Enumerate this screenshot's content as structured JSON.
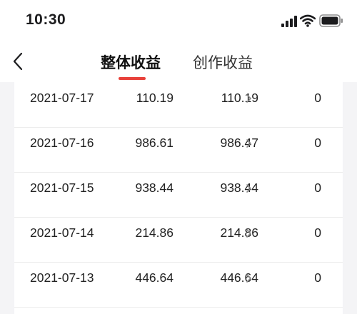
{
  "status_bar": {
    "time": "10:30"
  },
  "nav": {
    "tabs": [
      {
        "label": "整体收益",
        "active": true
      },
      {
        "label": "创作收益",
        "active": false
      }
    ],
    "accent_color": "#e8413a"
  },
  "rows": [
    {
      "date": "2021-07-17",
      "total": "110.19",
      "creation": "110.19",
      "other": "0"
    },
    {
      "date": "2021-07-16",
      "total": "986.61",
      "creation": "986.47",
      "other": "0"
    },
    {
      "date": "2021-07-15",
      "total": "938.44",
      "creation": "938.44",
      "other": "0"
    },
    {
      "date": "2021-07-14",
      "total": "214.86",
      "creation": "214.86",
      "other": "0"
    },
    {
      "date": "2021-07-13",
      "total": "446.64",
      "creation": "446.64",
      "other": "0"
    }
  ],
  "icons": {
    "back": "chevron-left-icon",
    "row_detail": "chevron-right-icon",
    "signal": "cellular-signal-icon",
    "wifi": "wifi-icon",
    "battery": "battery-icon"
  }
}
